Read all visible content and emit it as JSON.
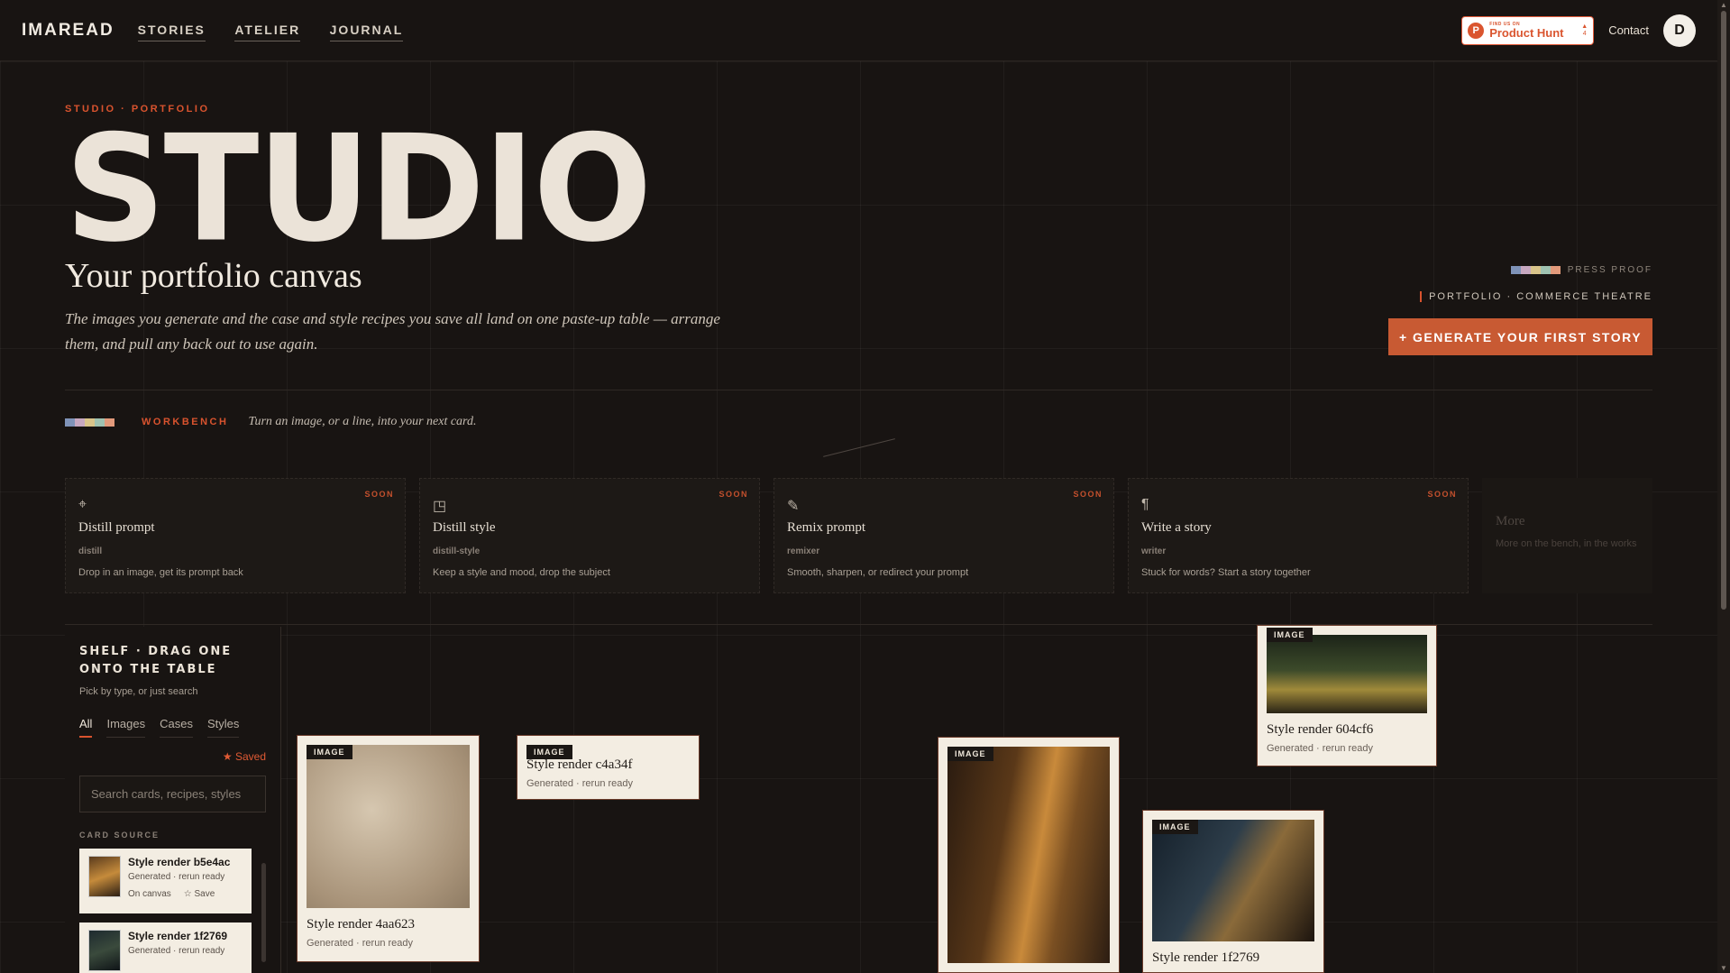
{
  "header": {
    "logo": "IMAREAD",
    "nav": [
      "STORIES",
      "ATELIER",
      "JOURNAL"
    ],
    "product_hunt": {
      "small": "FIND US ON",
      "label": "Product Hunt",
      "arrow": "▲",
      "count": "4"
    },
    "contact": "Contact",
    "avatar_initial": "D"
  },
  "hero": {
    "eyebrow": "STUDIO · PORTFOLIO",
    "title": "STUDIO",
    "subtitle": "Your portfolio canvas",
    "description": "The images you generate and the case and style recipes you save all land on one paste-up table — arrange them, and pull any back out to use again.",
    "press_label": "PRESS PROOF",
    "portfolio_tag": "PORTFOLIO · COMMERCE THEATRE",
    "cta_label": "+ GENERATE YOUR FIRST STORY"
  },
  "workbench": {
    "label": "WORKBENCH",
    "note": "Turn an image, or a line, into your next card.",
    "tools": [
      {
        "icon": "⌖",
        "title": "Distill prompt",
        "code": "distill",
        "desc": "Drop in an image, get its prompt back",
        "badge": "SOON"
      },
      {
        "icon": "◳",
        "title": "Distill style",
        "code": "distill-style",
        "desc": "Keep a style and mood, drop the subject",
        "badge": "SOON"
      },
      {
        "icon": "✎",
        "title": "Remix prompt",
        "code": "remixer",
        "desc": "Smooth, sharpen, or redirect your prompt",
        "badge": "SOON"
      },
      {
        "icon": "¶",
        "title": "Write a story",
        "code": "writer",
        "desc": "Stuck for words? Start a story together",
        "badge": "SOON"
      }
    ],
    "more": {
      "title": "More",
      "desc": "More on the bench, in the works"
    }
  },
  "shelf": {
    "title": "SHELF · DRAG ONE ONTO THE TABLE",
    "hint": "Pick by type, or just search",
    "tabs": [
      "All",
      "Images",
      "Cases",
      "Styles"
    ],
    "saved_label": "★ Saved",
    "search_placeholder": "Search cards, recipes, styles",
    "card_source_label": "CARD SOURCE",
    "items": [
      {
        "title": "Style render b5e4ac",
        "meta": "Generated · rerun ready",
        "status": "On canvas",
        "save": "☆ Save"
      },
      {
        "title": "Style render 1f2769",
        "meta": "Generated · rerun ready"
      }
    ]
  },
  "canvas": {
    "badge": "IMAGE",
    "cards": [
      {
        "title": "Style render 4aa623",
        "meta": "Generated · rerun ready"
      },
      {
        "title": "Style render c4a34f",
        "meta": "Generated · rerun ready"
      },
      {
        "title": "Style render 604cf6",
        "meta": "Generated · rerun ready"
      },
      {
        "title": "Style render 1f2769",
        "meta": ""
      }
    ]
  },
  "colors": {
    "accent": "#d9532e",
    "background": "#181412",
    "paper": "#f3ede2"
  },
  "swatch_colors": [
    "#7f93b8",
    "#c7a8c0",
    "#d9c48a",
    "#9fc2b1",
    "#e29a7b"
  ]
}
